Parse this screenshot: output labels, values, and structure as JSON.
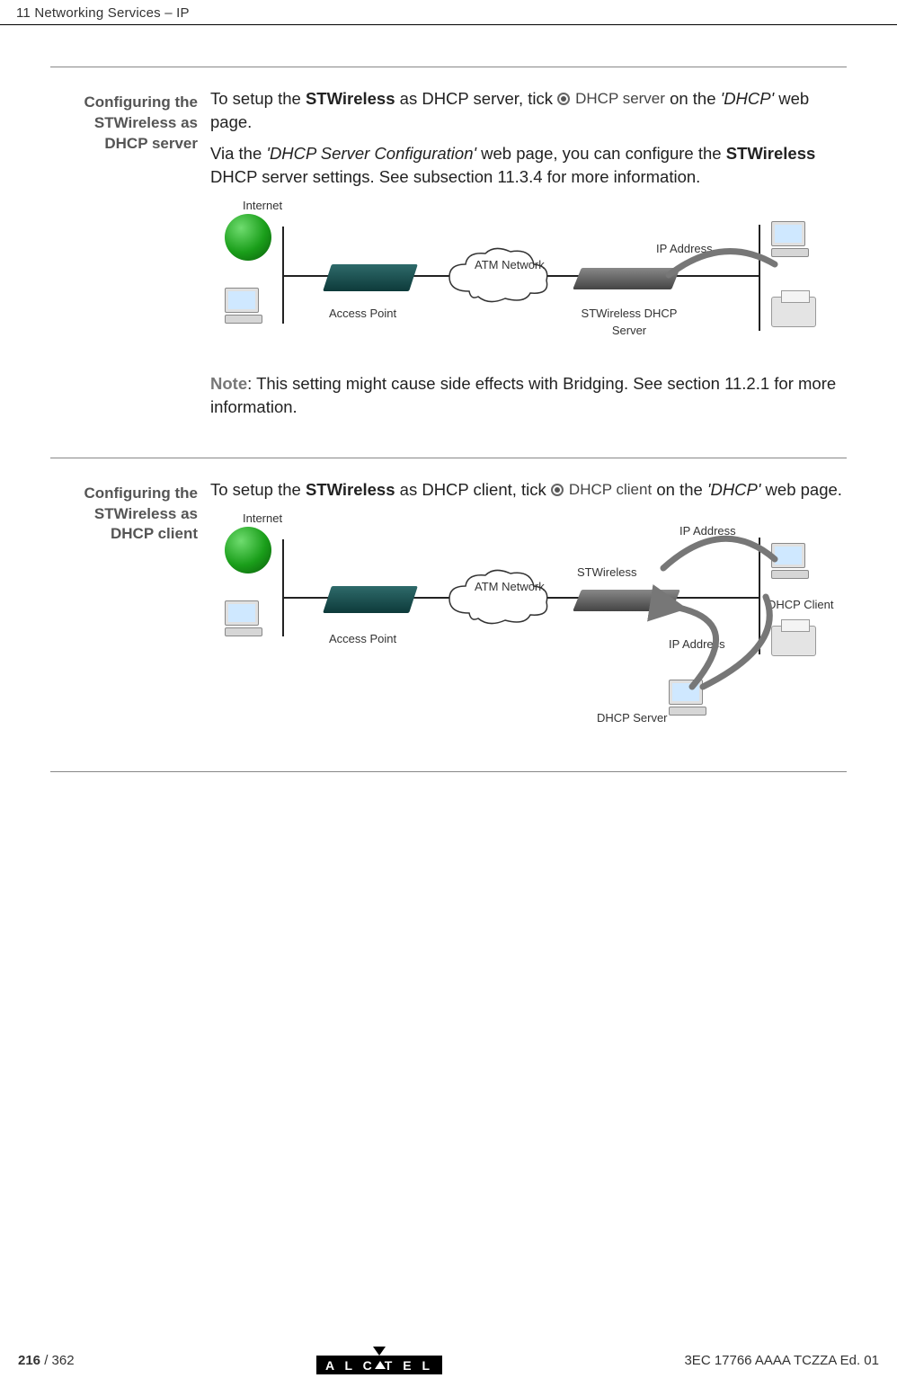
{
  "header": {
    "chapter": "11 Networking Services – IP"
  },
  "sections": {
    "server": {
      "heading": "Configuring the STWireless as DHCP server",
      "para1_pre": "To setup the ",
      "para1_bold": "STWireless",
      "para1_mid": " as DHCP server, tick ",
      "radio_label": "DHCP server",
      "para1_post_on": " on the ",
      "para1_page": "'DHCP'",
      "para1_end": " web page.",
      "para2_pre": "Via the ",
      "para2_italic": "'DHCP Server Configuration'",
      "para2_mid": " web page, you can configure the ",
      "para2_bold": "STWireless",
      "para2_end": " DHCP server settings. See subsection 11.3.4 for more information.",
      "note_label": "Note",
      "note_text": ": This setting might cause side effects with Bridging. See section 11.2.1 for more information."
    },
    "client": {
      "heading": "Configuring the STWireless as DHCP client",
      "para1_pre": "To setup the ",
      "para1_bold": "STWireless",
      "para1_mid": " as DHCP client, tick ",
      "radio_label": "DHCP client",
      "para1_post_on": " on the ",
      "para1_page": "'DHCP'",
      "para1_end": " web page."
    }
  },
  "diagram1": {
    "internet": "Internet",
    "access_point": "Access Point",
    "atm": "ATM Network",
    "stwireless": "STWireless DHCP Server",
    "ip_address": "IP Address"
  },
  "diagram2": {
    "internet": "Internet",
    "access_point": "Access Point",
    "atm": "ATM Network",
    "stwireless": "STWireless",
    "ip_address1": "IP Address",
    "ip_address2": "IP Address",
    "dhcp_client": "DHCP Client",
    "dhcp_server": "DHCP Server"
  },
  "footer": {
    "page_current": "216",
    "page_total": "362",
    "brand": "A L C   T E L",
    "docref": "3EC 17766 AAAA TCZZA Ed. 01"
  }
}
